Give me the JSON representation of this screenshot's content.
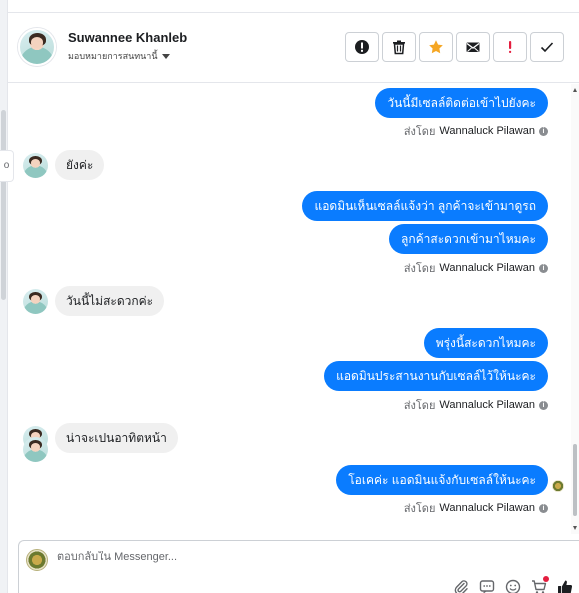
{
  "contact": {
    "name": "Suwannee Khanleb",
    "assign_label": "มอบหมายการสนทนานี้"
  },
  "messages": [
    {
      "dir": "out",
      "text": "วันนี้มีเซลล์ติดต่อเข้าไปยังคะ"
    },
    {
      "dir": "meta",
      "prefix": "ส่งโดย",
      "sender": "Wannaluck Pilawan"
    },
    {
      "dir": "in",
      "text": "ยังค่ะ"
    },
    {
      "dir": "out",
      "text": "แอดมินเห็นเซลล์แจ้งว่า ลูกค้าจะเข้ามาดูรถ"
    },
    {
      "dir": "out",
      "text": "ลูกค้าสะดวกเข้ามาไหมคะ"
    },
    {
      "dir": "meta",
      "prefix": "ส่งโดย",
      "sender": "Wannaluck Pilawan"
    },
    {
      "dir": "in",
      "text": "วันนี้ไม่สะดวกค่ะ"
    },
    {
      "dir": "out",
      "text": "พรุ่งนี้สะดวกไหมคะ"
    },
    {
      "dir": "out",
      "text": "แอดมินประสานงานกับเซลล์ไว้ให้นะคะ"
    },
    {
      "dir": "meta",
      "prefix": "ส่งโดย",
      "sender": "Wannaluck Pilawan"
    },
    {
      "dir": "in",
      "text": "น่าจะเปนอาทิตหน้า"
    },
    {
      "dir": "out",
      "text": "โอเคค่ะ แอดมินแจ้งกับเซลล์ให้นะคะ"
    },
    {
      "dir": "meta",
      "prefix": "ส่งโดย",
      "sender": "Wannaluck Pilawan"
    }
  ],
  "composer": {
    "placeholder": "ตอบกลับใน Messenger..."
  },
  "left_tab": "o",
  "icons": {
    "actions": [
      "alert-icon",
      "trash-icon",
      "star-icon",
      "envelope-icon",
      "exclamation-icon",
      "check-icon"
    ],
    "tools": [
      "paperclip-icon",
      "chat-icon",
      "emoji-icon",
      "cart-icon",
      "thumbs-up-icon"
    ]
  },
  "colors": {
    "outgoing_bubble": "#0a7cff",
    "incoming_bubble": "#f0f0f0",
    "star": "#f5a623",
    "exclamation": "#e41e3f"
  }
}
